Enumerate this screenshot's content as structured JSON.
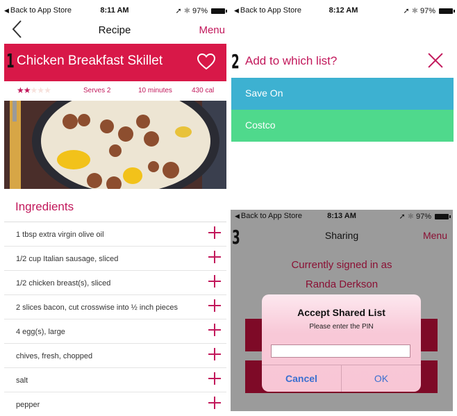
{
  "panel1": {
    "step": "1",
    "status": {
      "back": "Back to App Store",
      "time": "8:11 AM",
      "battery": "97%"
    },
    "nav": {
      "title": "Recipe",
      "menu": "Menu"
    },
    "recipe": {
      "title": "Chicken Breakfast Skillet",
      "rating": 2,
      "rating_max": 5,
      "serves": "Serves 2",
      "time": "10 minutes",
      "calories": "430 cal",
      "photo_alt": "Skillet with eggs, sausage and bacon"
    },
    "ingredients_title": "Ingredients",
    "ingredients": [
      "1 tbsp extra virgin olive oil",
      "1/2 cup Italian sausage, sliced",
      "1/2 chicken breast(s), sliced",
      "2 slices bacon, cut crosswise into ½ inch pieces",
      "4 egg(s), large",
      "chives, fresh, chopped",
      "salt",
      "pepper"
    ]
  },
  "panel2": {
    "step": "2",
    "status": {
      "back": "Back to App Store",
      "time": "8:12 AM",
      "battery": "97%"
    },
    "title": "Add to which list?",
    "lists": [
      {
        "label": "Save On",
        "color": "#3db1d1"
      },
      {
        "label": "Costco",
        "color": "#4fd98c"
      }
    ]
  },
  "panel3": {
    "step": "3",
    "status": {
      "back": "Back to App Store",
      "time": "8:13 AM",
      "battery": "97%"
    },
    "nav": {
      "title": "Sharing",
      "menu": "Menu"
    },
    "signed_in_label": "Currently signed in as",
    "user_name": "Randa Derkson",
    "alert": {
      "title": "Accept Shared List",
      "message": "Please enter the PIN",
      "input_value": "",
      "cancel": "Cancel",
      "ok": "OK"
    }
  },
  "colors": {
    "accent": "#d81848",
    "accent_text": "#c2185b",
    "dark_accent": "#7e0a27",
    "overlay_gray": "#9b9b9b",
    "ios_blue": "#3a6fd0"
  }
}
